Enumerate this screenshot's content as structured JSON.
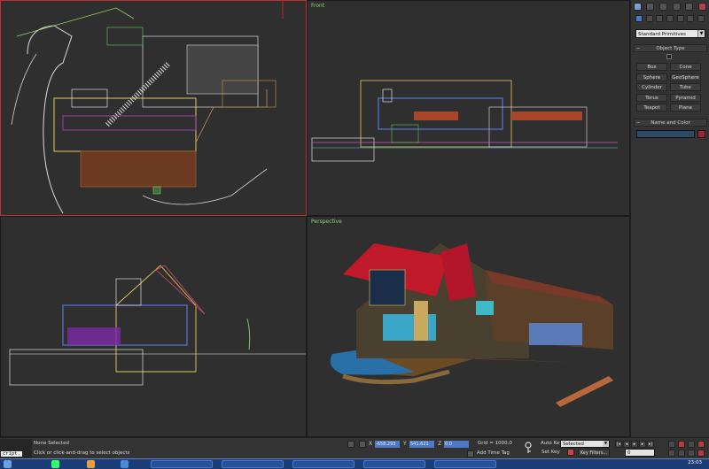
{
  "viewports": {
    "top": {
      "label": ""
    },
    "front": {
      "label": "Front"
    },
    "left": {
      "label": ""
    },
    "perspective": {
      "label": "Perspective"
    }
  },
  "command_panel": {
    "category_dropdown": "Standard Primitives",
    "object_type_title": "Object Type",
    "primitives": [
      "Box",
      "Cone",
      "Sphere",
      "GeoSphere",
      "Cylinder",
      "Tube",
      "Torus",
      "Pyramid",
      "Teapot",
      "Plane"
    ],
    "name_color_title": "Name and Color",
    "object_color": "#a0203a"
  },
  "status_bar": {
    "script_label": "cript.",
    "selection_status": "None Selected",
    "prompt": "Click or click-and-drag to select objects",
    "x_label": "X",
    "x_value": "-658.293",
    "y_label": "Y",
    "y_value": "541.621",
    "z_label": "Z",
    "z_value": "0.0",
    "grid": "Grid = 1000.0",
    "add_time_tag": "Add Time Tag",
    "auto_key": "Auto Key",
    "set_key": "Set Key",
    "selected_dropdown": "Selected",
    "key_filters": "Key Filters...",
    "frame": "0"
  },
  "taskbar": {
    "clock": "23:03"
  },
  "colors": {
    "active_viewport_border": "#c03030",
    "viewport_label": "#8ad36e",
    "selection_field": "#4e79c4"
  }
}
